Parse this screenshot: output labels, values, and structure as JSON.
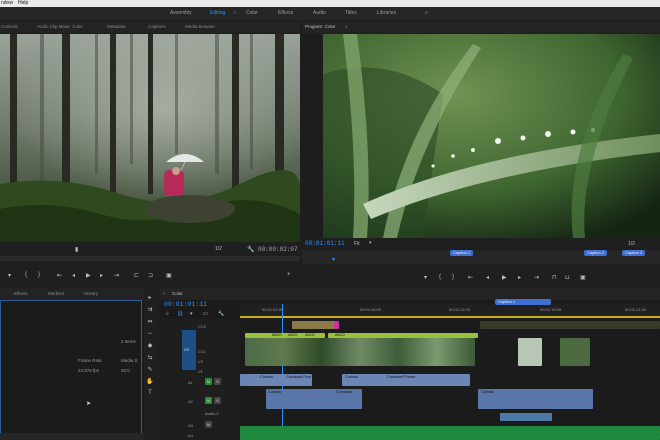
{
  "menu": {
    "window": "ndow",
    "help": "Help"
  },
  "workspaces": [
    "Assembly",
    "Editing",
    "Color",
    "Effects",
    "Audio",
    "Titles",
    "Libraries"
  ],
  "workspace_active": "Editing",
  "workspace_overflow": "»",
  "source_panel": {
    "tabs": [
      "Controls",
      "Audio Clip Mixer: Color",
      "Metadata",
      "Captions",
      "Media Browser"
    ],
    "fraction": "1/2",
    "timecode": "00:00:02:07"
  },
  "program_panel": {
    "title": "Program: Color",
    "menu_glyph": "≡",
    "timecode": "00:01:01:11",
    "fit": "Fit",
    "fraction": "1/2",
    "caption_markers": [
      "Caption 1",
      "Caption 2",
      "Caption 3"
    ]
  },
  "project_panel": {
    "tabs": [
      "Effects",
      "Markers",
      "History"
    ],
    "col_frame_rate": "Frame Rate",
    "col_media": "Media S",
    "val_frame_rate": "23.976 fps",
    "val_media": "00:0",
    "items": "2 Items"
  },
  "timeline": {
    "tab": "Color",
    "timecode": "00:01:01:11",
    "ruler": [
      "00:01:01:09",
      "00:01:06:09",
      "00:01:11:09",
      "00:01:16:09",
      "00:01:21:09"
    ],
    "caption_marker": "Caption 1",
    "tracks": [
      "CC2",
      "V3",
      "CC1",
      "V2",
      "V1",
      "A1",
      "A2",
      "Audio 2",
      "A3",
      "A4"
    ],
    "clip_labels": {
      "constant1": "Consta",
      "constant_pow": "Constant Pow",
      "constant2": "Consta",
      "constant_power": "Constant Power",
      "constant_a2a": "Consta",
      "constant_a2b": "Constant",
      "constant_a2c": "Consta"
    },
    "caption_chips": [
      "ABCD",
      "ABCD",
      "ABCD",
      "ABCD"
    ]
  },
  "colors": {
    "accent": "#2f8fff",
    "video_clip": "#3c5b3a",
    "audio_clip": "#6b86b5",
    "audio_green": "#1f8a3e",
    "caption_badge": "#3f6fd0"
  }
}
